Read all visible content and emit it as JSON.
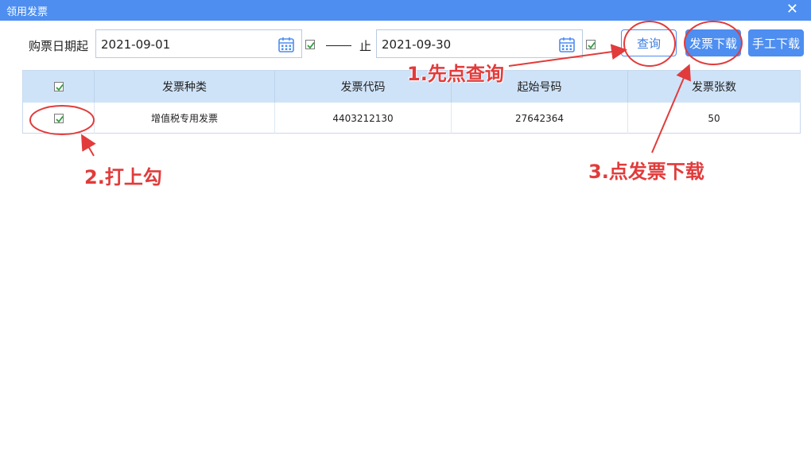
{
  "window": {
    "title": "领用发票",
    "close_glyph": "✕"
  },
  "query": {
    "start_label": "购票日期起",
    "start_date": "2021-09-01",
    "range_sep": "止",
    "end_date": "2021-09-30"
  },
  "buttons": {
    "query": "查询",
    "download_invoice": "发票下载",
    "manual_download": "手工下载"
  },
  "table": {
    "columns": [
      "发票种类",
      "发票代码",
      "起始号码",
      "发票张数"
    ],
    "rows": [
      {
        "type": "增值税专用发票",
        "code": "4403212130",
        "start_no": "27642364",
        "count": "50"
      }
    ]
  },
  "annotations": {
    "step1": "1.先点查询",
    "step2": "2.打上勾",
    "step3": "3.点发票下载",
    "color": "#e23b3b"
  },
  "colors": {
    "accent": "#4d8ef0",
    "header_bg": "#cfe3f8",
    "check": "#2e9e3e"
  }
}
